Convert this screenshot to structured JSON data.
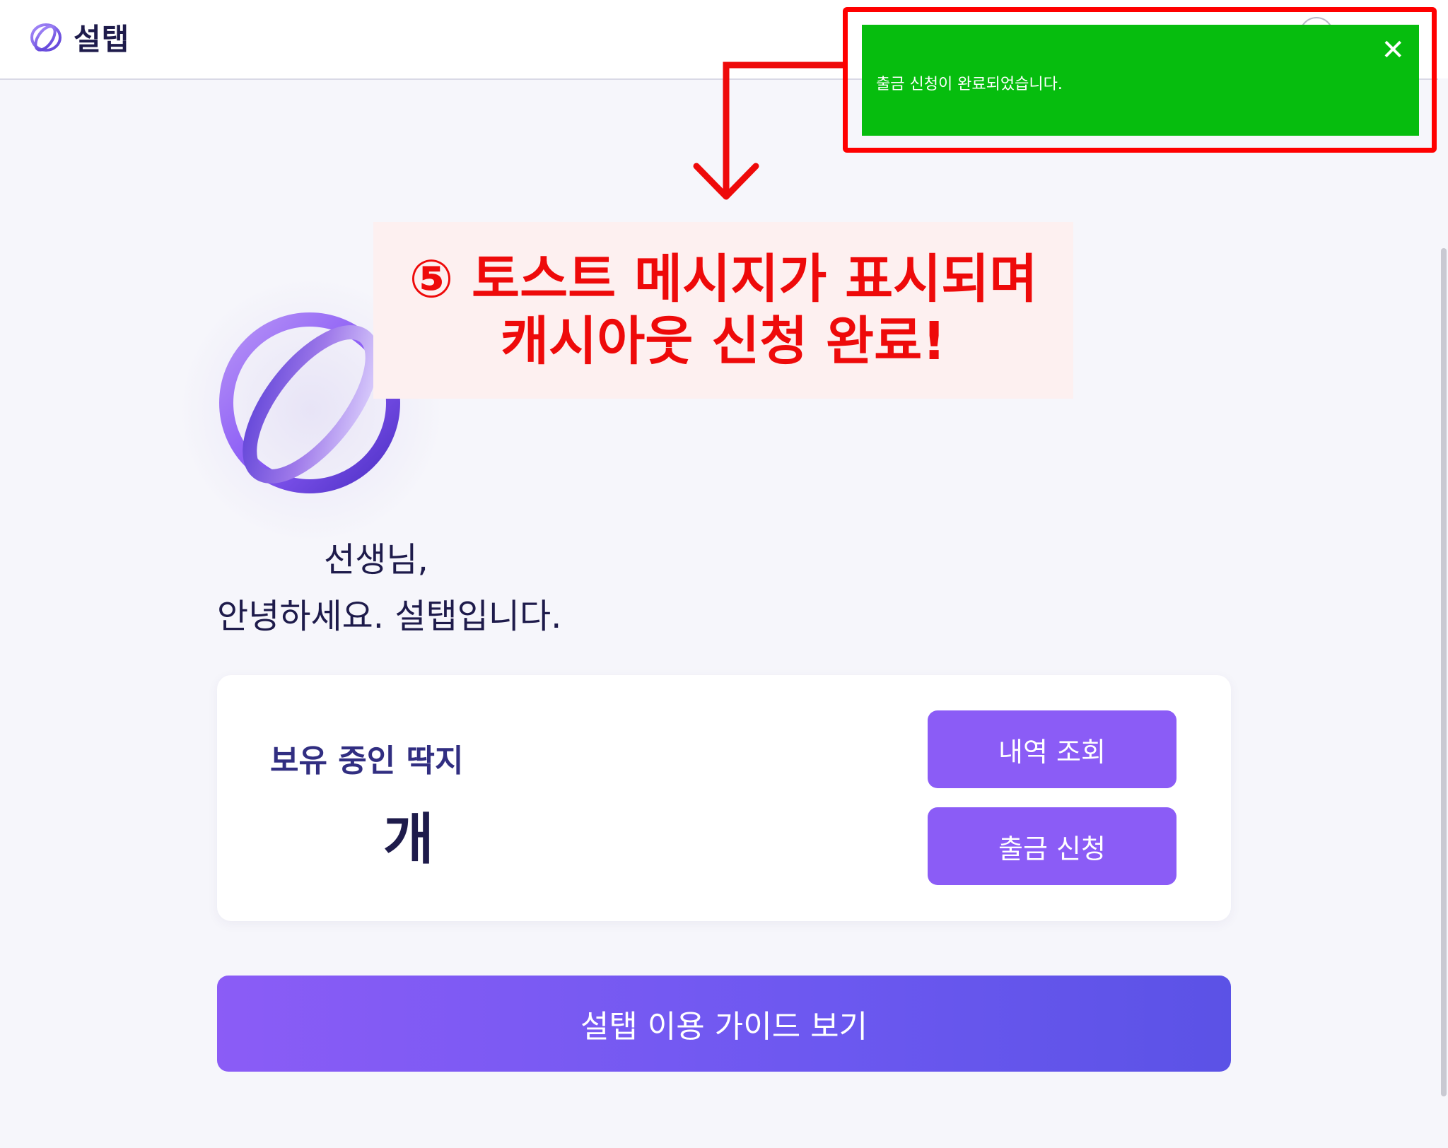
{
  "header": {
    "brand_name": "설탭",
    "brand_icon": "sultab-logo-icon",
    "avatar_icon": "user-avatar-icon"
  },
  "hero": {
    "logo_icon": "sultab-orbit-logo-icon",
    "greeting_name": "선생님,",
    "greeting_line": "안녕하세요. 설탭입니다."
  },
  "card": {
    "label": "보유 중인 딱지",
    "count_unit": "개",
    "history_button": "내역 조회",
    "withdraw_button": "출금 신청"
  },
  "guide_button": "설탭 이용 가이드 보기",
  "toast": {
    "message": "출금 신청이 완료되었습니다.",
    "close_symbol": "✕",
    "background_color": "#06bd0e"
  },
  "annotation": {
    "line1": "⑤ 토스트 메시지가 표시되며",
    "line2": "캐시아웃 신청 완료!",
    "color": "#ee0a0a"
  },
  "colors": {
    "accent": "#8b5cf6",
    "text_primary": "#1e1b4b",
    "background": "#f6f6fb"
  }
}
